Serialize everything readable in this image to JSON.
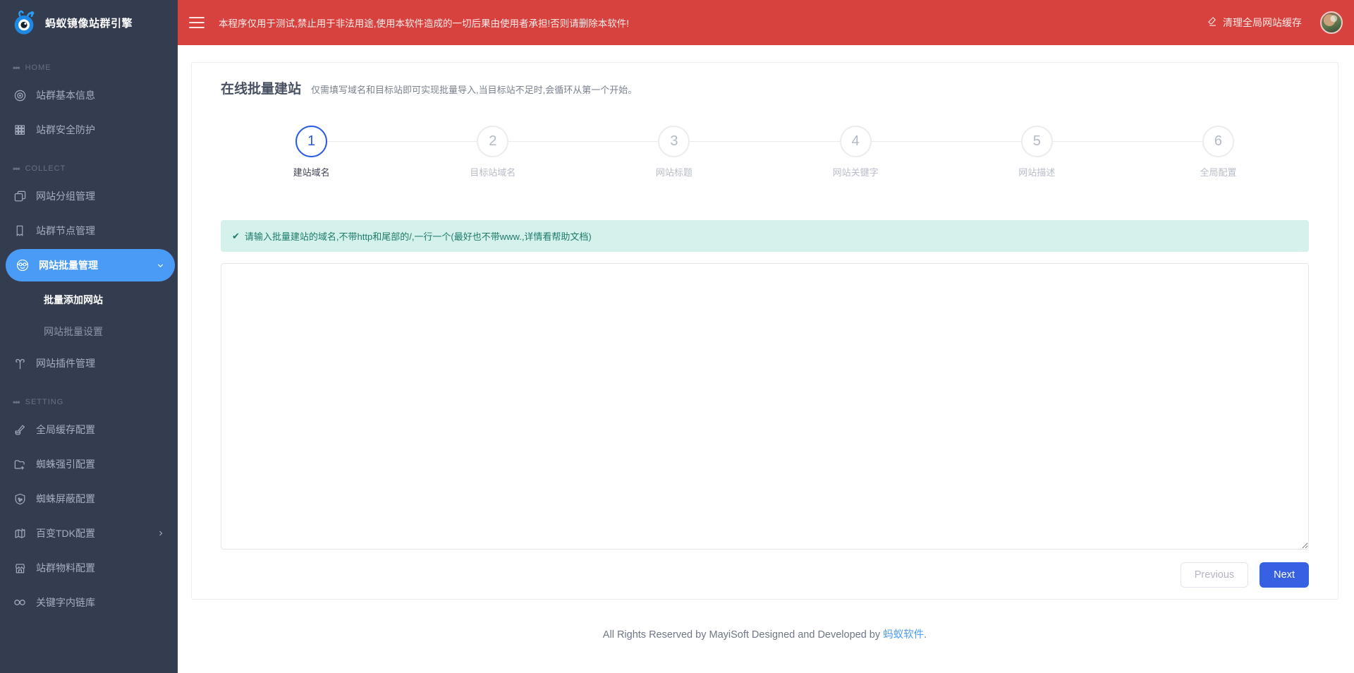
{
  "sidebar": {
    "logo": {
      "title": "蚂蚁镜像站群引擎"
    },
    "sections": [
      {
        "label": "HOME",
        "items": [
          {
            "label": "站群基本信息",
            "icon": "badge-circle-icon"
          },
          {
            "label": "站群安全防护",
            "icon": "grid-icon"
          }
        ]
      },
      {
        "label": "COLLECT",
        "items": [
          {
            "label": "网站分组管理",
            "icon": "folders-icon"
          },
          {
            "label": "站群节点管理",
            "icon": "bookmark-icon"
          },
          {
            "label": "网站批量管理",
            "icon": "smiley-glasses-icon",
            "active": true,
            "children": [
              {
                "label": "批量添加网站",
                "active": true
              },
              {
                "label": "网站批量设置",
                "active": false
              }
            ]
          },
          {
            "label": "网站插件管理",
            "icon": "plugin-icon"
          }
        ]
      },
      {
        "label": "SETTING",
        "items": [
          {
            "label": "全局缓存配置",
            "icon": "brush-icon"
          },
          {
            "label": "蜘蛛强引配置",
            "icon": "folder-plus-icon"
          },
          {
            "label": "蜘蛛屏蔽配置",
            "icon": "shield-icon"
          },
          {
            "label": "百变TDK配置",
            "icon": "map-pen-icon",
            "has_submenu": true
          },
          {
            "label": "站群物料配置",
            "icon": "store-icon"
          },
          {
            "label": "关键字内链库",
            "icon": "links-icon"
          }
        ]
      }
    ]
  },
  "topbar": {
    "warning": "本程序仅用于测试,禁止用于非法用途,使用本软件造成的一切后果由使用者承担!否则请删除本软件!",
    "clear_cache_label": "清理全局网站缓存"
  },
  "page": {
    "title": "在线批量建站",
    "subtitle": "仅需填写域名和目标站即可实现批量导入,当目标站不足时,会循环从第一个开始。"
  },
  "wizard": {
    "steps": [
      {
        "num": "1",
        "label": "建站域名"
      },
      {
        "num": "2",
        "label": "目标站域名"
      },
      {
        "num": "3",
        "label": "网站标题"
      },
      {
        "num": "4",
        "label": "网站关键字"
      },
      {
        "num": "5",
        "label": "网站描述"
      },
      {
        "num": "6",
        "label": "全局配置"
      }
    ],
    "alert": {
      "icon": "✔",
      "text": "请输入批量建站的域名,不带http和尾部的/,一行一个(最好也不带www.,详情看帮助文档)"
    },
    "textarea_value": "",
    "prev_label": "Previous",
    "next_label": "Next"
  },
  "footer": {
    "text": "All Rights Reserved by MayiSoft Designed and Developed by",
    "link": "蚂蚁软件",
    "suffix": "."
  },
  "colors": {
    "topbar_red": "#d8423e",
    "sidebar_bg": "#343d50",
    "active_item_blue": "#4a9bf5",
    "step_active_blue": "#2b5ce0",
    "next_button_blue": "#3561e2",
    "alert_teal_bg": "#d4f1ec",
    "alert_teal_text": "#1e7a6a"
  }
}
